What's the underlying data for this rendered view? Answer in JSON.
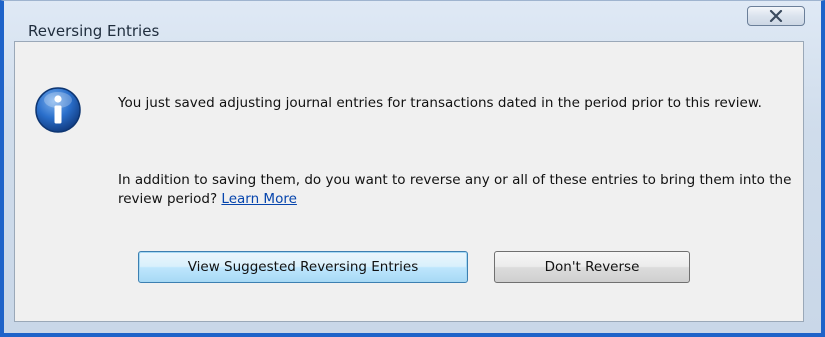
{
  "window": {
    "title": "Reversing Entries",
    "close_glyph": "X"
  },
  "message": {
    "line1": "You just saved adjusting journal entries for transactions dated in the period prior to this review.",
    "line2_text": "In addition to saving them, do you want to reverse any or all of these entries to bring them into the review period?",
    "learn_more": "Learn More"
  },
  "buttons": {
    "view_suggested": "View Suggested Reversing Entries",
    "dont_reverse": "Don't Reverse"
  },
  "icons": {
    "info": "info-icon",
    "close": "close-icon"
  },
  "colors": {
    "window_border": "#1e63c9",
    "link": "#0645ad",
    "info_icon": "#1b5fb8"
  }
}
